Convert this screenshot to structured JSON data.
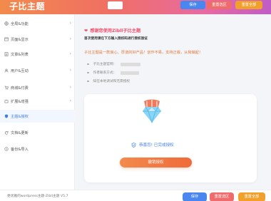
{
  "header": {
    "brand": "子比主题",
    "save_label": "保存",
    "reset_section_label": "重置选区",
    "reset_all_label": "重置全部"
  },
  "sidebar": {
    "items": [
      {
        "label": "全局&功能",
        "icon": "globe-icon",
        "has_chevron": true
      },
      {
        "label": "页面&显示",
        "icon": "window-icon",
        "has_chevron": true
      },
      {
        "label": "文章&列表",
        "icon": "document-icon",
        "has_chevron": true
      },
      {
        "label": "用户&互动",
        "icon": "user-icon",
        "has_chevron": true
      },
      {
        "label": "商城&付费",
        "icon": "cart-icon",
        "has_chevron": true
      },
      {
        "label": "扩展&增强",
        "icon": "puzzle-icon",
        "has_chevron": true
      },
      {
        "label": "主题&授权",
        "icon": "shield-icon",
        "has_chevron": false,
        "active": true
      },
      {
        "label": "文档&更新",
        "icon": "refresh-icon",
        "has_chevron": false
      },
      {
        "label": "备份&导入",
        "icon": "backup-icon",
        "has_chevron": false
      }
    ]
  },
  "panel": {
    "thanks_title": "感谢您使用Zibll子比主题",
    "first_use_text": "首次使用请在下方输入授权码进行授权验证",
    "note": "子比主题是一款良心、厚道的好产品！创作不易，支持正版，从我做起！",
    "info_rows": [
      {
        "label": "子比主题官网："
      },
      {
        "label": "作者联系方式："
      },
      {
        "label": "知在本地调试和无需授权"
      }
    ]
  },
  "auth_card": {
    "status": "恭喜您! 已完成授权",
    "revoke_label": "撤销授权"
  },
  "footer": {
    "text": "更优雅的wordpress主题-Zibll主题 V5.7",
    "save_label": "保存",
    "reset_section_label": "重置选区",
    "reset_all_label": "重置全部"
  },
  "colors": {
    "accent_blue": "#3f7ee8",
    "save_blue": "#4a86f0",
    "reset_red": "#f06b6b",
    "reset_all_orange": "#f0a02b",
    "thanks_pink": "#f0506e",
    "note_orange": "#e0763a"
  }
}
